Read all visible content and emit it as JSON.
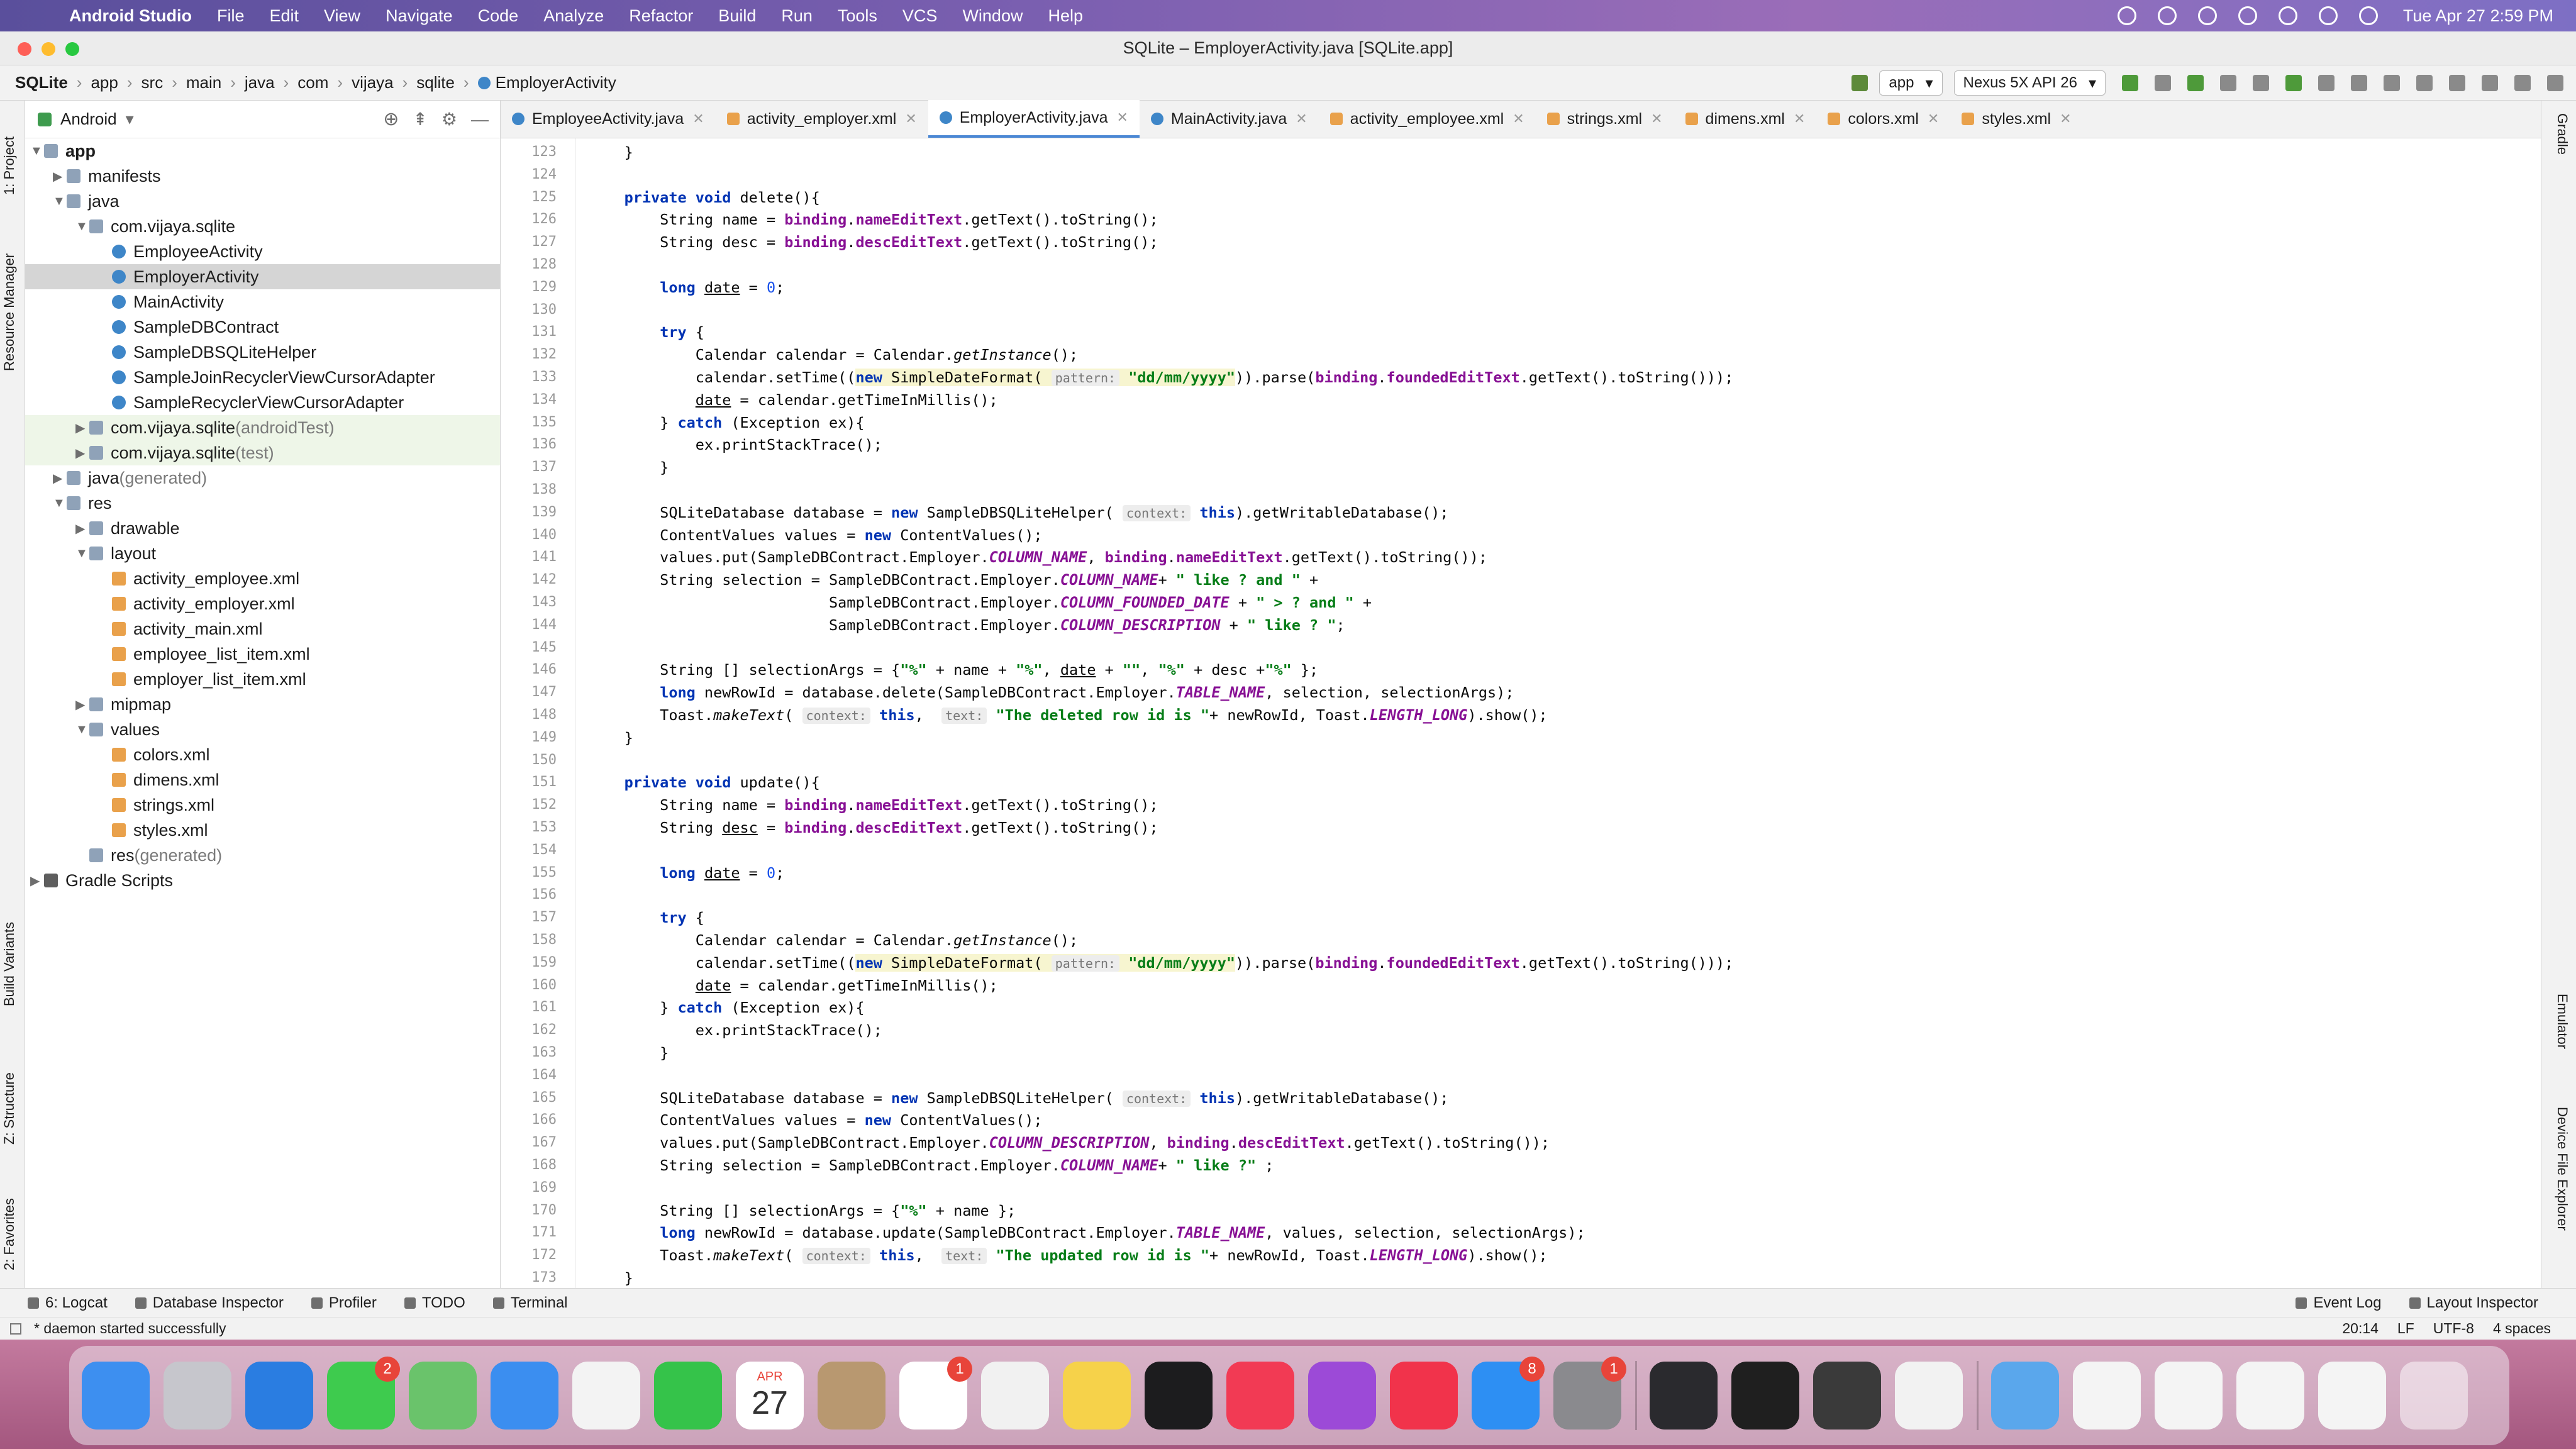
{
  "menubar": {
    "app_name": "Android Studio",
    "items": [
      "File",
      "Edit",
      "View",
      "Navigate",
      "Code",
      "Analyze",
      "Refactor",
      "Build",
      "Run",
      "Tools",
      "VCS",
      "Window",
      "Help"
    ],
    "datetime": "Tue Apr 27  2:59 PM"
  },
  "window_title": "SQLite – EmployerActivity.java [SQLite.app]",
  "breadcrumb": [
    "SQLite",
    "app",
    "src",
    "main",
    "java",
    "com",
    "vijaya",
    "sqlite",
    "EmployerActivity"
  ],
  "toolbar": {
    "module": "app",
    "device": "Nexus 5X API 26"
  },
  "project_panel": {
    "view": "Android",
    "tree": [
      {
        "label": "app",
        "indent": 0,
        "arrow": "▼",
        "icon": "folder",
        "bold": true
      },
      {
        "label": "manifests",
        "indent": 1,
        "arrow": "▶",
        "icon": "folder"
      },
      {
        "label": "java",
        "indent": 1,
        "arrow": "▼",
        "icon": "folder"
      },
      {
        "label": "com.vijaya.sqlite",
        "indent": 2,
        "arrow": "▼",
        "icon": "folder"
      },
      {
        "label": "EmployeeActivity",
        "indent": 3,
        "arrow": "",
        "icon": "cls"
      },
      {
        "label": "EmployerActivity",
        "indent": 3,
        "arrow": "",
        "icon": "cls",
        "selected": true
      },
      {
        "label": "MainActivity",
        "indent": 3,
        "arrow": "",
        "icon": "cls"
      },
      {
        "label": "SampleDBContract",
        "indent": 3,
        "arrow": "",
        "icon": "cls"
      },
      {
        "label": "SampleDBSQLiteHelper",
        "indent": 3,
        "arrow": "",
        "icon": "cls"
      },
      {
        "label": "SampleJoinRecyclerViewCursorAdapter",
        "indent": 3,
        "arrow": "",
        "icon": "cls"
      },
      {
        "label": "SampleRecyclerViewCursorAdapter",
        "indent": 3,
        "arrow": "",
        "icon": "cls"
      },
      {
        "label": "com.vijaya.sqlite",
        "suffix": " (androidTest)",
        "indent": 2,
        "arrow": "▶",
        "icon": "folder",
        "test": true
      },
      {
        "label": "com.vijaya.sqlite",
        "suffix": " (test)",
        "indent": 2,
        "arrow": "▶",
        "icon": "folder",
        "test": true
      },
      {
        "label": "java",
        "suffix": " (generated)",
        "indent": 1,
        "arrow": "▶",
        "icon": "folder"
      },
      {
        "label": "res",
        "indent": 1,
        "arrow": "▼",
        "icon": "folder"
      },
      {
        "label": "drawable",
        "indent": 2,
        "arrow": "▶",
        "icon": "folder"
      },
      {
        "label": "layout",
        "indent": 2,
        "arrow": "▼",
        "icon": "folder"
      },
      {
        "label": "activity_employee.xml",
        "indent": 3,
        "arrow": "",
        "icon": "xml"
      },
      {
        "label": "activity_employer.xml",
        "indent": 3,
        "arrow": "",
        "icon": "xml"
      },
      {
        "label": "activity_main.xml",
        "indent": 3,
        "arrow": "",
        "icon": "xml"
      },
      {
        "label": "employee_list_item.xml",
        "indent": 3,
        "arrow": "",
        "icon": "xml"
      },
      {
        "label": "employer_list_item.xml",
        "indent": 3,
        "arrow": "",
        "icon": "xml"
      },
      {
        "label": "mipmap",
        "indent": 2,
        "arrow": "▶",
        "icon": "folder"
      },
      {
        "label": "values",
        "indent": 2,
        "arrow": "▼",
        "icon": "folder"
      },
      {
        "label": "colors.xml",
        "indent": 3,
        "arrow": "",
        "icon": "xml"
      },
      {
        "label": "dimens.xml",
        "indent": 3,
        "arrow": "",
        "icon": "xml"
      },
      {
        "label": "strings.xml",
        "indent": 3,
        "arrow": "",
        "icon": "xml"
      },
      {
        "label": "styles.xml",
        "indent": 3,
        "arrow": "",
        "icon": "xml"
      },
      {
        "label": "res",
        "suffix": " (generated)",
        "indent": 2,
        "arrow": "",
        "icon": "folder"
      },
      {
        "label": "Gradle Scripts",
        "indent": 0,
        "arrow": "▶",
        "icon": "mod"
      }
    ]
  },
  "tabs": [
    {
      "label": "EmployeeActivity.java",
      "icon": "cls"
    },
    {
      "label": "activity_employer.xml",
      "icon": "xml"
    },
    {
      "label": "EmployerActivity.java",
      "icon": "cls",
      "active": true
    },
    {
      "label": "MainActivity.java",
      "icon": "cls"
    },
    {
      "label": "activity_employee.xml",
      "icon": "xml"
    },
    {
      "label": "strings.xml",
      "icon": "xml"
    },
    {
      "label": "dimens.xml",
      "icon": "xml"
    },
    {
      "label": "colors.xml",
      "icon": "xml"
    },
    {
      "label": "styles.xml",
      "icon": "xml"
    }
  ],
  "code_lines": [
    {
      "n": "123",
      "html": "    }"
    },
    {
      "n": "124",
      "html": ""
    },
    {
      "n": "125",
      "html": "    <span class=\"kw\">private void</span> delete(){"
    },
    {
      "n": "126",
      "html": "        String name = <span class=\"fn\">binding</span>.<span class=\"fn\">nameEditText</span>.getText().toString();"
    },
    {
      "n": "127",
      "html": "        String desc = <span class=\"fn\">binding</span>.<span class=\"fn\">descEditText</span>.getText().toString();"
    },
    {
      "n": "128",
      "html": ""
    },
    {
      "n": "129",
      "html": "        <span class=\"kw\">long</span> <span class=\"udl\">date</span> = <span class=\"num\">0</span>;"
    },
    {
      "n": "130",
      "html": ""
    },
    {
      "n": "131",
      "html": "        <span class=\"kw\">try</span> {"
    },
    {
      "n": "132",
      "html": "            Calendar calendar = Calendar.<span class=\"it\">getInstance</span>();"
    },
    {
      "n": "133",
      "html": "            calendar.setTime((<span class=\"hl\"><span class=\"kw\">new</span> SimpleDateFormat( <span class=\"hint\">pattern:</span> <span class=\"st\">\"dd/mm/yyyy\"</span></span>)).parse(<span class=\"fn\">binding</span>.<span class=\"fn\">foundedEditText</span>.getText().toString()));"
    },
    {
      "n": "134",
      "html": "            <span class=\"udl\">date</span> = calendar.getTimeInMillis();"
    },
    {
      "n": "135",
      "html": "        } <span class=\"kw\">catch</span> (Exception ex){"
    },
    {
      "n": "136",
      "html": "            ex.printStackTrace();"
    },
    {
      "n": "137",
      "html": "        }"
    },
    {
      "n": "138",
      "html": ""
    },
    {
      "n": "139",
      "html": "        SQLiteDatabase database = <span class=\"kw\">new</span> SampleDBSQLiteHelper( <span class=\"hint\">context:</span> <span class=\"kw\">this</span>).getWritableDatabase();"
    },
    {
      "n": "140",
      "html": "        ContentValues values = <span class=\"kw\">new</span> ContentValues();"
    },
    {
      "n": "141",
      "html": "        values.put(SampleDBContract.Employer.<span class=\"cs\">COLUMN_NAME</span>, <span class=\"fn\">binding</span>.<span class=\"fn\">nameEditText</span>.getText().toString());"
    },
    {
      "n": "142",
      "html": "        String selection = SampleDBContract.Employer.<span class=\"cs\">COLUMN_NAME</span>+ <span class=\"st\">\" like ? and \"</span> +"
    },
    {
      "n": "143",
      "html": "                           SampleDBContract.Employer.<span class=\"cs\">COLUMN_FOUNDED_DATE</span> + <span class=\"st\">\" > ? and \"</span> +"
    },
    {
      "n": "144",
      "html": "                           SampleDBContract.Employer.<span class=\"cs\">COLUMN_DESCRIPTION</span> + <span class=\"st\">\" like ? \"</span>;"
    },
    {
      "n": "145",
      "html": ""
    },
    {
      "n": "146",
      "html": "        String [] selectionArgs = {<span class=\"st\">\"%\"</span> + name + <span class=\"st\">\"%\"</span>, <span class=\"udl\">date</span> + <span class=\"st\">\"\"</span>, <span class=\"st\">\"%\"</span> + desc +<span class=\"st\">\"%\"</span> };"
    },
    {
      "n": "147",
      "html": "        <span class=\"kw\">long</span> newRowId = database.delete(SampleDBContract.Employer.<span class=\"cs\">TABLE_NAME</span>, selection, selectionArgs);"
    },
    {
      "n": "148",
      "html": "        Toast.<span class=\"it\">makeText</span>( <span class=\"hint\">context:</span> <span class=\"kw\">this</span>,  <span class=\"hint\">text:</span> <span class=\"st\">\"The deleted row id is \"</span>+ newRowId, Toast.<span class=\"cs\">LENGTH_LONG</span>).show();"
    },
    {
      "n": "149",
      "html": "    }"
    },
    {
      "n": "150",
      "html": ""
    },
    {
      "n": "151",
      "html": "    <span class=\"kw\">private void</span> update(){"
    },
    {
      "n": "152",
      "html": "        String name = <span class=\"fn\">binding</span>.<span class=\"fn\">nameEditText</span>.getText().toString();"
    },
    {
      "n": "153",
      "html": "        String <span class=\"udl\">desc</span> = <span class=\"fn\">binding</span>.<span class=\"fn\">descEditText</span>.getText().toString();"
    },
    {
      "n": "154",
      "html": ""
    },
    {
      "n": "155",
      "html": "        <span class=\"kw\">long</span> <span class=\"udl\">date</span> = <span class=\"num\">0</span>;"
    },
    {
      "n": "156",
      "html": ""
    },
    {
      "n": "157",
      "html": "        <span class=\"kw\">try</span> {"
    },
    {
      "n": "158",
      "html": "            Calendar calendar = Calendar.<span class=\"it\">getInstance</span>();"
    },
    {
      "n": "159",
      "html": "            calendar.setTime((<span class=\"hl\"><span class=\"kw\">new</span> SimpleDateFormat( <span class=\"hint\">pattern:</span> <span class=\"st\">\"dd/mm/yyyy\"</span></span>)).parse(<span class=\"fn\">binding</span>.<span class=\"fn\">foundedEditText</span>.getText().toString()));"
    },
    {
      "n": "160",
      "html": "            <span class=\"udl\">date</span> = calendar.getTimeInMillis();"
    },
    {
      "n": "161",
      "html": "        } <span class=\"kw\">catch</span> (Exception ex){"
    },
    {
      "n": "162",
      "html": "            ex.printStackTrace();"
    },
    {
      "n": "163",
      "html": "        }"
    },
    {
      "n": "164",
      "html": ""
    },
    {
      "n": "165",
      "html": "        SQLiteDatabase database = <span class=\"kw\">new</span> SampleDBSQLiteHelper( <span class=\"hint\">context:</span> <span class=\"kw\">this</span>).getWritableDatabase();"
    },
    {
      "n": "166",
      "html": "        ContentValues values = <span class=\"kw\">new</span> ContentValues();"
    },
    {
      "n": "167",
      "html": "        values.put(SampleDBContract.Employer.<span class=\"cs\">COLUMN_DESCRIPTION</span>, <span class=\"fn\">binding</span>.<span class=\"fn\">descEditText</span>.getText().toString());"
    },
    {
      "n": "168",
      "html": "        String selection = SampleDBContract.Employer.<span class=\"cs\">COLUMN_NAME</span>+ <span class=\"st\">\" like ?\"</span> ;"
    },
    {
      "n": "169",
      "html": ""
    },
    {
      "n": "170",
      "html": "        String [] selectionArgs = {<span class=\"st\">\"%\"</span> + name };"
    },
    {
      "n": "171",
      "html": "        <span class=\"kw\">long</span> newRowId = database.update(SampleDBContract.Employer.<span class=\"cs\">TABLE_NAME</span>, values, selection, selectionArgs);"
    },
    {
      "n": "172",
      "html": "        Toast.<span class=\"it\">makeText</span>( <span class=\"hint\">context:</span> <span class=\"kw\">this</span>,  <span class=\"hint\">text:</span> <span class=\"st\">\"The updated row id is \"</span>+ newRowId, Toast.<span class=\"cs\">LENGTH_LONG</span>).show();"
    },
    {
      "n": "173",
      "html": "    }"
    }
  ],
  "left_strip_labels": [
    "1: Project",
    "Resource Manager",
    "Build Variants",
    "Z: Structure",
    "2: Favorites"
  ],
  "right_strip_labels": [
    "Gradle",
    "Emulator",
    "Device File Explorer"
  ],
  "bottom_tools": [
    "6: Logcat",
    "Database Inspector",
    "Profiler",
    "TODO",
    "Terminal"
  ],
  "bottom_right_tools": [
    "Event Log",
    "Layout Inspector"
  ],
  "status": {
    "message": "* daemon started successfully",
    "position": "20:14",
    "line_sep": "LF",
    "encoding": "UTF-8",
    "indent": "4 spaces"
  },
  "dock": {
    "calendar_month": "APR",
    "calendar_day": "27",
    "apps": [
      {
        "name": "finder",
        "color": "#3d8ff0"
      },
      {
        "name": "launchpad",
        "color": "#c6c6cc"
      },
      {
        "name": "safari",
        "color": "#2a7de1"
      },
      {
        "name": "messages",
        "color": "#3ecb4e",
        "badge": "2"
      },
      {
        "name": "maps",
        "color": "#6ac36b"
      },
      {
        "name": "mail",
        "color": "#3b8ef0"
      },
      {
        "name": "photos",
        "color": "#f3f3f3"
      },
      {
        "name": "facetime",
        "color": "#35c34a"
      },
      {
        "name": "calendar",
        "color": "#ffffff"
      },
      {
        "name": "contacts",
        "color": "#b89870"
      },
      {
        "name": "reminders",
        "color": "#ffffff",
        "badge": "1"
      },
      {
        "name": "chrome",
        "color": "#f1f1f1"
      },
      {
        "name": "notes",
        "color": "#f6d24a"
      },
      {
        "name": "apple-tv",
        "color": "#1c1c1e"
      },
      {
        "name": "music",
        "color": "#f23a54"
      },
      {
        "name": "podcasts",
        "color": "#9c4ad7"
      },
      {
        "name": "news",
        "color": "#f1334b"
      },
      {
        "name": "app-store",
        "color": "#2d8ff3",
        "badge": "8"
      },
      {
        "name": "system-preferences",
        "color": "#8a8a8e",
        "badge": "1"
      },
      {
        "name": "xcode-tools",
        "color": "#2a2a2e"
      },
      {
        "name": "terminal",
        "color": "#1f1f1f"
      },
      {
        "name": "sublime-text",
        "color": "#3a3a3a"
      },
      {
        "name": "android-studio",
        "color": "#f2f2f2"
      }
    ]
  }
}
